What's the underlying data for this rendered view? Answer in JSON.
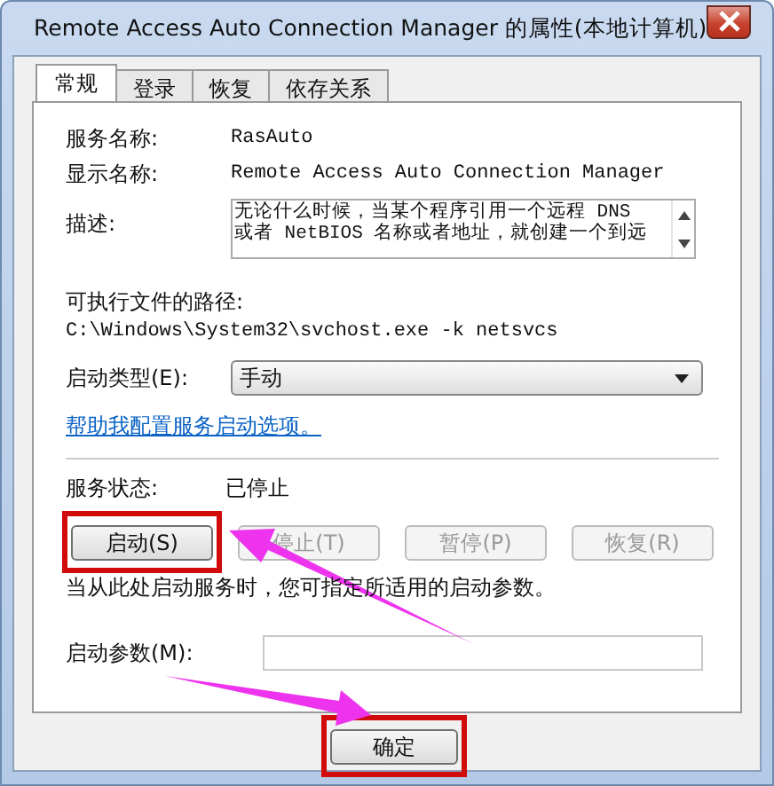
{
  "window": {
    "title": "Remote Access Auto Connection Manager 的属性(本地计算机)"
  },
  "tabs": [
    {
      "label": "常规",
      "selected": true
    },
    {
      "label": "登录",
      "selected": false
    },
    {
      "label": "恢复",
      "selected": false
    },
    {
      "label": "依存关系",
      "selected": false
    }
  ],
  "service_name": {
    "label": "服务名称:",
    "value": "RasAuto"
  },
  "display_name": {
    "label": "显示名称:",
    "value": "Remote Access Auto Connection Manager"
  },
  "description": {
    "label": "描述:",
    "lines": [
      "无论什么时候，当某个程序引用一个远程 DNS",
      "或者 NetBIOS 名称或者地址，就创建一个到远"
    ]
  },
  "executable_path": {
    "label": "可执行文件的路径:",
    "value": "C:\\Windows\\System32\\svchost.exe -k netsvcs"
  },
  "startup_type": {
    "label": "启动类型(E):",
    "value": "手动"
  },
  "help_link": "帮助我配置服务启动选项。",
  "service_status": {
    "label": "服务状态:",
    "value": "已停止"
  },
  "control_buttons": [
    {
      "label": "启动(S)",
      "disabled": false,
      "highlighted": true
    },
    {
      "label": "停止(T)",
      "disabled": true,
      "highlighted": false
    },
    {
      "label": "暂停(P)",
      "disabled": true,
      "highlighted": false
    },
    {
      "label": "恢复(R)",
      "disabled": true,
      "highlighted": false
    }
  ],
  "hint": "当从此处启动服务时，您可指定所适用的启动参数。",
  "start_parameters": {
    "label": "启动参数(M):"
  },
  "ok_button": {
    "label": "确定",
    "highlighted": true
  }
}
